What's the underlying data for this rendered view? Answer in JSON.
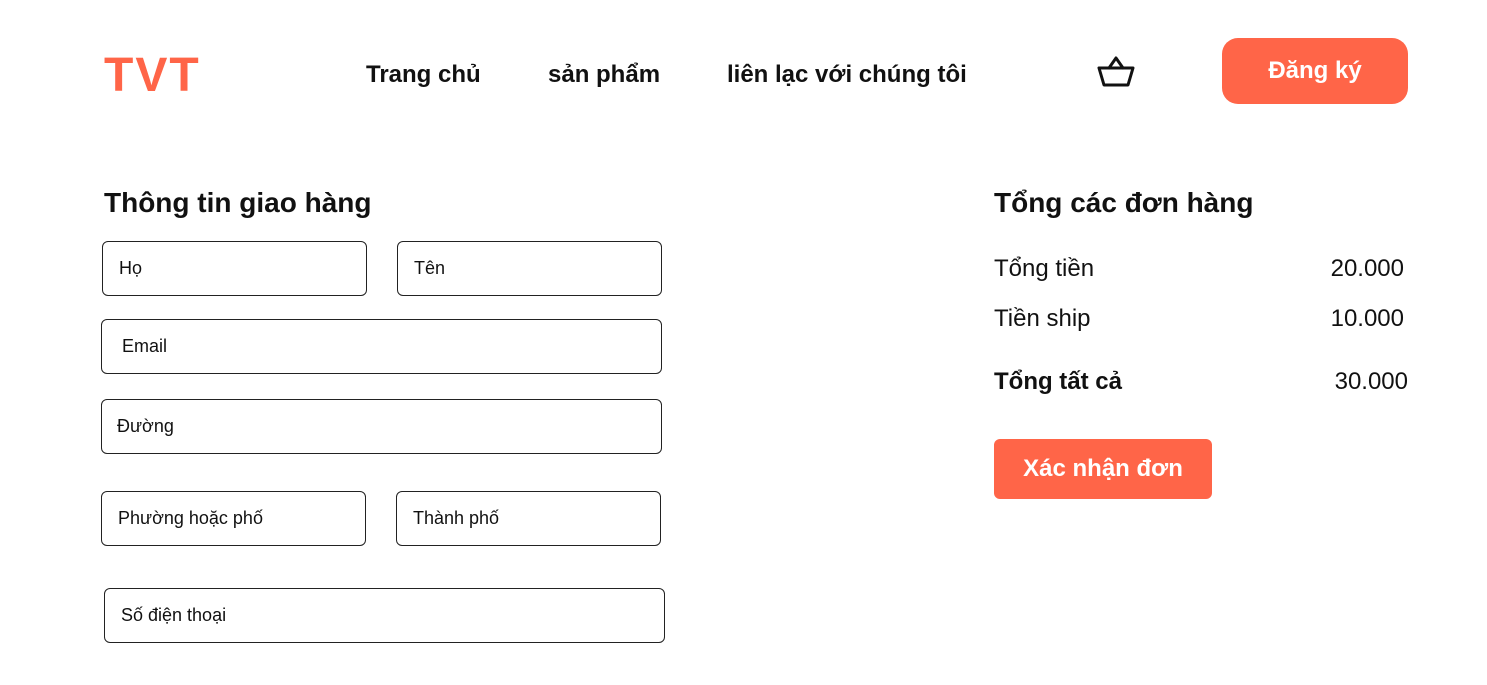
{
  "header": {
    "logo": "TVT",
    "nav": [
      "Trang chủ",
      "sản phẩm",
      "liên lạc với chúng tôi"
    ],
    "cart_icon": "basket-icon",
    "signup_label": "Đăng ký"
  },
  "shipping": {
    "title": "Thông tin giao hàng",
    "fields": {
      "ho": "Họ",
      "ten": "Tên",
      "email": "Email",
      "duong": "Đường",
      "phuong": "Phường hoặc phố",
      "thanh_pho": "Thành phố",
      "phone": "Số điện thoại"
    }
  },
  "summary": {
    "title": "Tổng các đơn hàng",
    "rows": [
      {
        "label": "Tổng tiền",
        "value": "20.000"
      },
      {
        "label": "Tiền ship",
        "value": "10.000"
      },
      {
        "label": "Tổng tất cả",
        "value": "30.000"
      }
    ],
    "confirm_label": "Xác nhận đơn"
  },
  "colors": {
    "accent": "#ff6548",
    "text": "#111111",
    "border": "#222222"
  }
}
